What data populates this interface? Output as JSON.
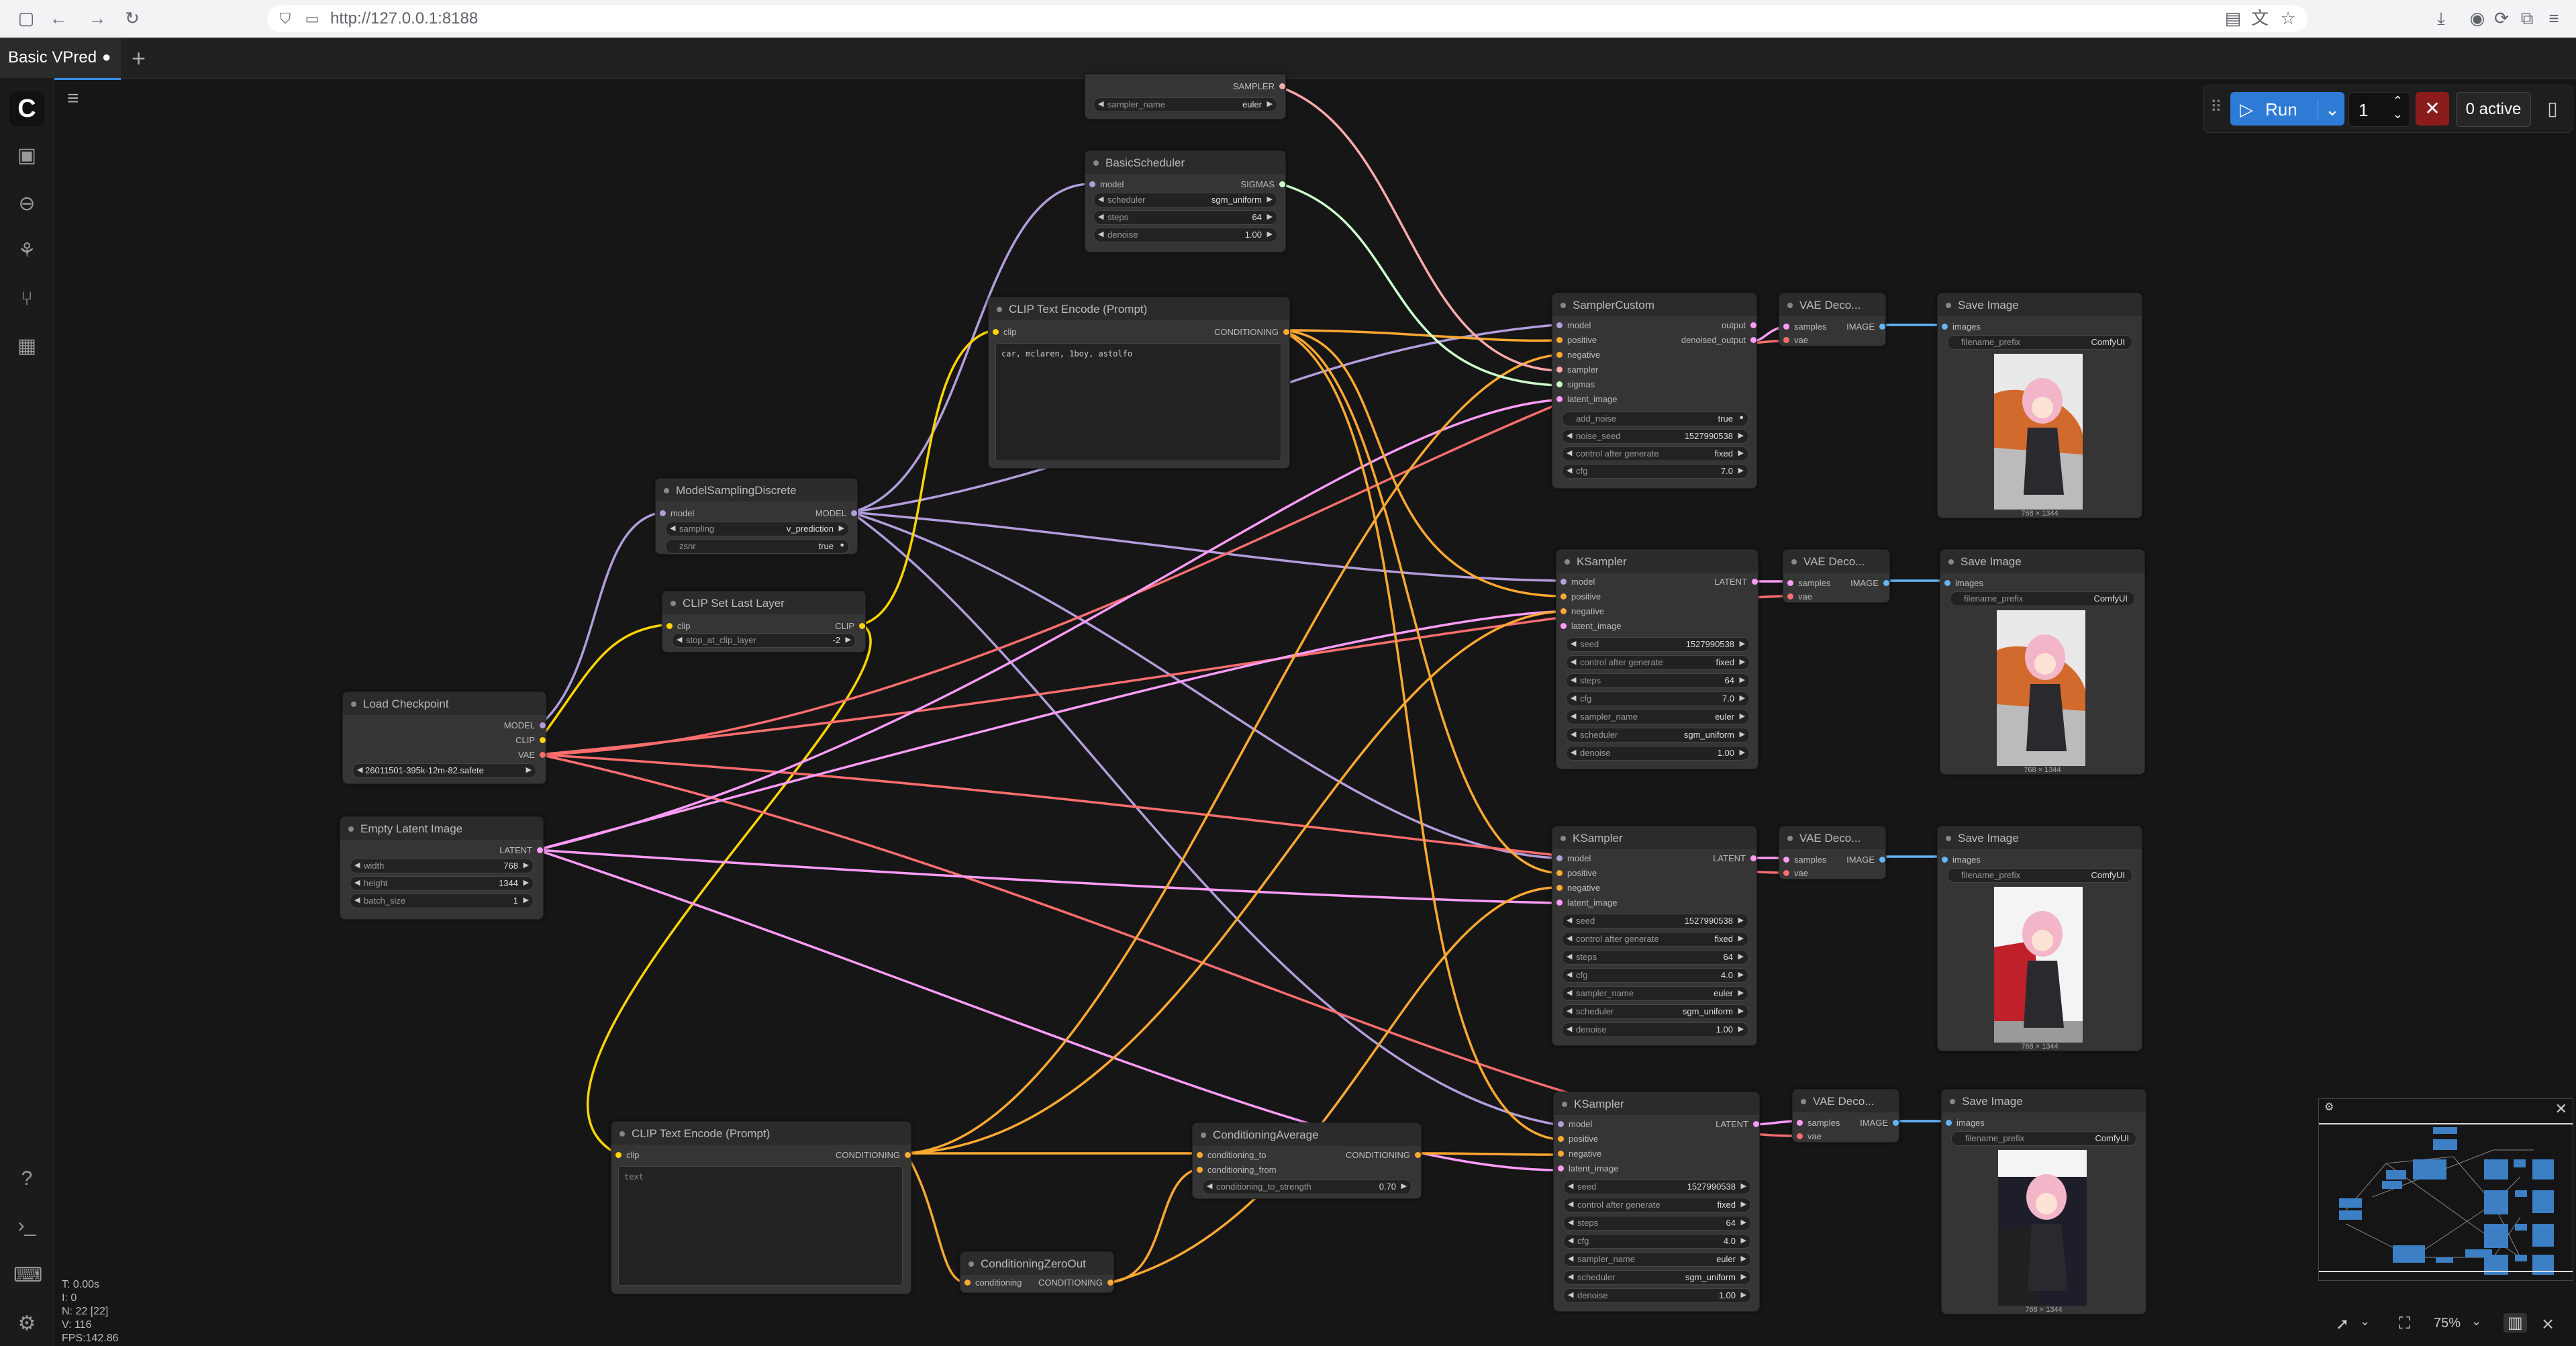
{
  "browser": {
    "url": "http://127.0.0.1:8188"
  },
  "tabs": [
    {
      "label": "Basic VPred",
      "modified": "●"
    }
  ],
  "toolbar": {
    "run_label": "Run",
    "queue_count": "1",
    "active_label": "0 active"
  },
  "stats": {
    "t": "T: 0.00s",
    "i": "I: 0",
    "n": "N: 22 [22]",
    "v": "V: 116",
    "fps": "FPS:142.86"
  },
  "zoom": "75%",
  "colors": {
    "model": "#b39ddb",
    "clip": "#ffd500",
    "vae": "#ff6e6e",
    "latent": "#ff9cf9",
    "conditioning": "#ffa931",
    "image": "#64b5f6",
    "sampler": "#ffaaaa",
    "sigmas": "#cdffcd",
    "accent": "#2e7bd6"
  },
  "nodes": {
    "sampler_select": {
      "title": "",
      "out_sampler": "SAMPLER",
      "w_sampler_name": {
        "label": "sampler_name",
        "value": "euler"
      }
    },
    "basic_scheduler": {
      "title": "BasicScheduler",
      "in_model": "model",
      "out_sigmas": "SIGMAS",
      "w_scheduler": {
        "label": "scheduler",
        "value": "sgm_uniform"
      },
      "w_steps": {
        "label": "steps",
        "value": "64"
      },
      "w_denoise": {
        "label": "denoise",
        "value": "1.00"
      }
    },
    "clip_text_top": {
      "title": "CLIP Text Encode (Prompt)",
      "in_clip": "clip",
      "out_cond": "CONDITIONING",
      "text": "car, mclaren, 1boy, astolfo"
    },
    "model_sampling": {
      "title": "ModelSamplingDiscrete",
      "in_model": "model",
      "out_model": "MODEL",
      "w_sampling": {
        "label": "sampling",
        "value": "v_prediction"
      },
      "w_zsnr": {
        "label": "zsnr",
        "value": "true"
      }
    },
    "clip_set_last": {
      "title": "CLIP Set Last Layer",
      "in_clip": "clip",
      "out_clip": "CLIP",
      "w_stop": {
        "label": "stop_at_clip_layer",
        "value": "-2"
      }
    },
    "load_checkpoint": {
      "title": "Load Checkpoint",
      "out_model": "MODEL",
      "out_clip": "CLIP",
      "out_vae": "VAE",
      "w_ckpt": {
        "value": "26011501-395k-12m-82.safete"
      }
    },
    "empty_latent": {
      "title": "Empty Latent Image",
      "out_latent": "LATENT",
      "w_width": {
        "label": "width",
        "value": "768"
      },
      "w_height": {
        "label": "height",
        "value": "1344"
      },
      "w_batch": {
        "label": "batch_size",
        "value": "1"
      }
    },
    "clip_text_bottom": {
      "title": "CLIP Text Encode (Prompt)",
      "in_clip": "clip",
      "out_cond": "CONDITIONING",
      "text": "text"
    },
    "cond_zero": {
      "title": "ConditioningZeroOut",
      "in_cond": "conditioning",
      "out_cond": "CONDITIONING"
    },
    "cond_avg": {
      "title": "ConditioningAverage",
      "in_to": "conditioning_to",
      "in_from": "conditioning_from",
      "out_cond": "CONDITIONING",
      "w_strength": {
        "label": "conditioning_to_strength",
        "value": "0.70"
      }
    },
    "sampler_custom": {
      "title": "SamplerCustom",
      "inputs": [
        "model",
        "positive",
        "negative",
        "sampler",
        "sigmas",
        "latent_image"
      ],
      "out_output": "output",
      "out_denoised": "denoised_output",
      "w_add_noise": {
        "label": "add_noise",
        "value": "true"
      },
      "w_noise_seed": {
        "label": "noise_seed",
        "value": "1527990538"
      },
      "w_control": {
        "label": "control after generate",
        "value": "fixed"
      },
      "w_cfg": {
        "label": "cfg",
        "value": "7.0"
      }
    },
    "ksampler1": {
      "title": "KSampler",
      "inputs": [
        "model",
        "positive",
        "negative",
        "latent_image"
      ],
      "out_latent": "LATENT",
      "widgets": [
        {
          "label": "seed",
          "value": "1527990538"
        },
        {
          "label": "control after generate",
          "value": "fixed"
        },
        {
          "label": "steps",
          "value": "64"
        },
        {
          "label": "cfg",
          "value": "7.0"
        },
        {
          "label": "sampler_name",
          "value": "euler"
        },
        {
          "label": "scheduler",
          "value": "sgm_uniform"
        },
        {
          "label": "denoise",
          "value": "1.00"
        }
      ]
    },
    "ksampler2": {
      "title": "KSampler",
      "inputs": [
        "model",
        "positive",
        "negative",
        "latent_image"
      ],
      "out_latent": "LATENT",
      "widgets": [
        {
          "label": "seed",
          "value": "1527990538"
        },
        {
          "label": "control after generate",
          "value": "fixed"
        },
        {
          "label": "steps",
          "value": "64"
        },
        {
          "label": "cfg",
          "value": "4.0"
        },
        {
          "label": "sampler_name",
          "value": "euler"
        },
        {
          "label": "scheduler",
          "value": "sgm_uniform"
        },
        {
          "label": "denoise",
          "value": "1.00"
        }
      ]
    },
    "ksampler3": {
      "title": "KSampler",
      "inputs": [
        "model",
        "positive",
        "negative",
        "latent_image"
      ],
      "out_latent": "LATENT",
      "widgets": [
        {
          "label": "seed",
          "value": "1527990538"
        },
        {
          "label": "control after generate",
          "value": "fixed"
        },
        {
          "label": "steps",
          "value": "64"
        },
        {
          "label": "cfg",
          "value": "4.0"
        },
        {
          "label": "sampler_name",
          "value": "euler"
        },
        {
          "label": "scheduler",
          "value": "sgm_uniform"
        },
        {
          "label": "denoise",
          "value": "1.00"
        }
      ]
    },
    "vae_decode": {
      "title": "VAE Deco...",
      "in_samples": "samples",
      "in_vae": "vae",
      "out_image": "IMAGE"
    },
    "save_image": {
      "title": "Save Image",
      "in_images": "images",
      "w_prefix": {
        "label": "filename_prefix",
        "value": "ComfyUI"
      },
      "caption": "768 × 1344"
    }
  }
}
